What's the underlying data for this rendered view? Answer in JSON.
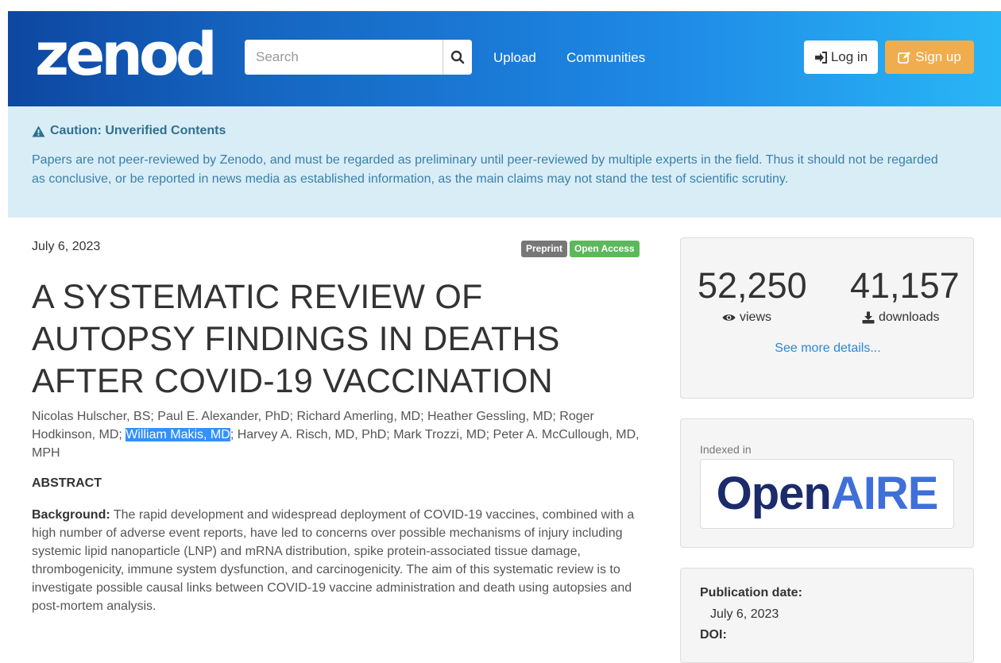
{
  "header": {
    "logo_text": "zenodo",
    "search_placeholder": "Search",
    "nav": [
      "Upload",
      "Communities"
    ],
    "login_label": "Log in",
    "signup_label": "Sign up"
  },
  "caution": {
    "title": "Caution: Unverified Contents",
    "text": "Papers are not peer-reviewed by Zenodo, and must be regarded as preliminary until peer-reviewed by multiple experts in the field. Thus it should not be regarded as conclusive, or be reported in news media as established information, as the main claims may not stand the test of scientific scrutiny."
  },
  "record": {
    "date": "July 6, 2023",
    "badges": [
      "Preprint",
      "Open Access"
    ],
    "title": "A SYSTEMATIC REVIEW OF AUTOPSY FINDINGS IN DEATHS AFTER COVID-19 VACCINATION",
    "authors_before": "Nicolas Hulscher, BS; Paul E. Alexander, PhD; Richard Amerling, MD; Heather Gessling, MD; Roger Hodkinson, MD; ",
    "authors_highlighted": "William Makis, MD",
    "authors_after": "; Harvey A. Risch, MD, PhD; Mark Trozzi, MD; Peter A. McCullough, MD, MPH",
    "abstract_heading": "ABSTRACT",
    "abstract_lead": "Background:",
    "abstract_text": " The rapid development and widespread deployment of COVID-19 vaccines, combined with a high number of adverse event reports, have led to concerns over possible mechanisms of injury including systemic lipid nanoparticle (LNP) and mRNA distribution, spike protein-associated tissue damage, thrombogenicity, immune system dysfunction, and carcinogenicity. The aim of this systematic review is to investigate possible causal links between COVID-19 vaccine administration and death using autopsies and post-mortem analysis."
  },
  "stats": {
    "views_count": "52,250",
    "views_label": "views",
    "downloads_count": "41,157",
    "downloads_label": "downloads",
    "details_link": "See more details..."
  },
  "indexed": {
    "label": "Indexed in",
    "logo_part1": "Open",
    "logo_part2": "AIRE"
  },
  "meta": {
    "pub_date_label": "Publication date:",
    "pub_date_value": "July 6, 2023",
    "doi_label": "DOI:"
  }
}
